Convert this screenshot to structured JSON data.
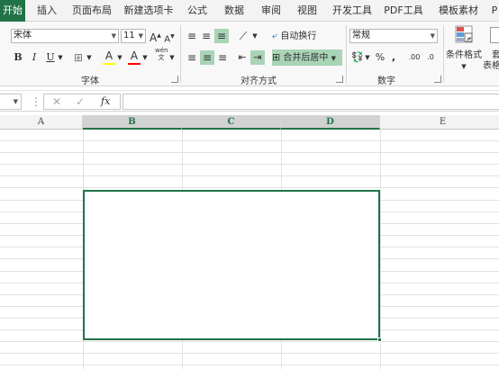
{
  "tabs": [
    "开始",
    "插入",
    "页面布局",
    "新建选项卡",
    "公式",
    "数据",
    "审阅",
    "视图",
    "开发工具",
    "PDF工具",
    "模板素材",
    "P"
  ],
  "font": {
    "name": "宋体",
    "size": "11",
    "grow_label": "A",
    "shrink_label": "A",
    "bold_label": "B",
    "italic_label": "I",
    "underline_label": "U",
    "fill_label": "A",
    "font_color_label": "A",
    "phonetic_label": "wén",
    "group_label": "字体"
  },
  "alignment": {
    "wrap_text_label": "自动换行",
    "merge_center_label": "合并后居中",
    "group_label": "对齐方式"
  },
  "number": {
    "format": "常规",
    "percent_label": "%",
    "comma_label": ",",
    "increase_decimal_label": ".00",
    "decrease_decimal_label": ".0",
    "group_label": "数字"
  },
  "styles": {
    "conditional_format_label": "条件格式",
    "table_format_label_1": "套",
    "table_format_label_2": "表格"
  },
  "formula_bar": {
    "more_label": "⋮",
    "cancel_label": "✕",
    "enter_label": "✓",
    "fx_label": "fx"
  },
  "columns": [
    "A",
    "B",
    "C",
    "D",
    "E"
  ],
  "colors": {
    "accent": "#217346",
    "highlight": "#a9d4b6",
    "fill_yellow": "#ffff00",
    "font_red": "#ff0000"
  }
}
